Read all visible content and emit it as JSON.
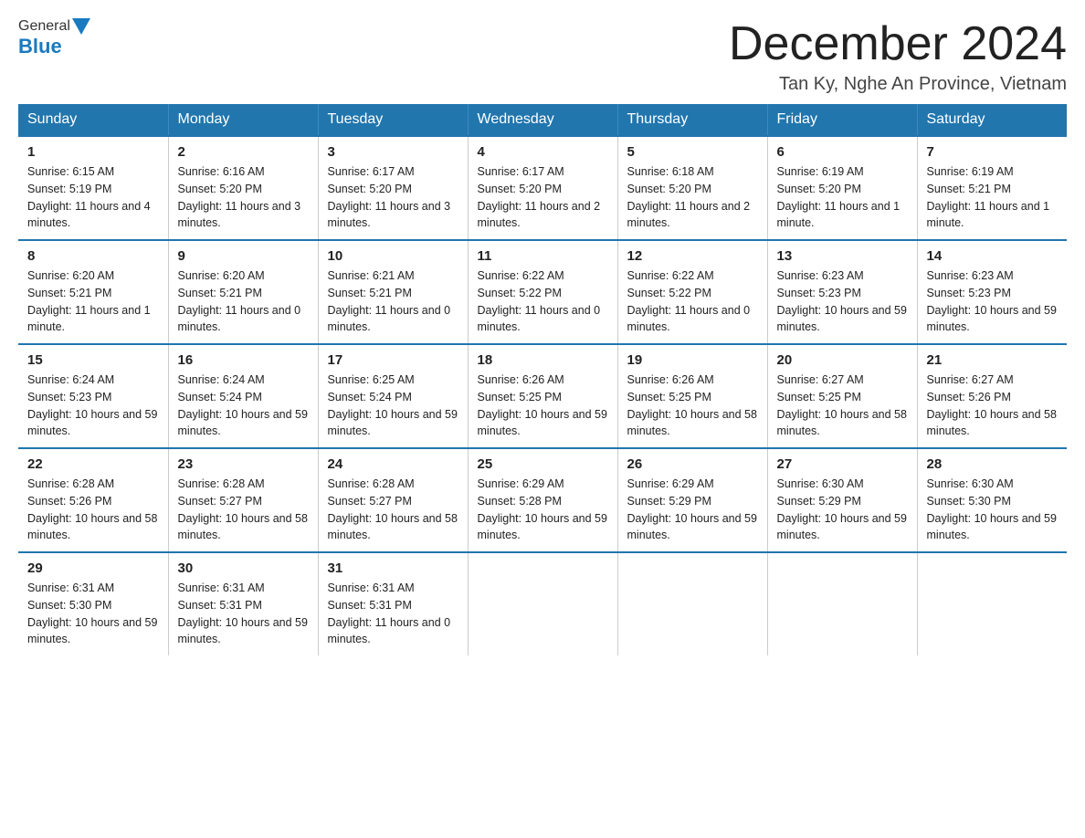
{
  "header": {
    "logo_general": "General",
    "logo_blue": "Blue",
    "month_title": "December 2024",
    "location": "Tan Ky, Nghe An Province, Vietnam"
  },
  "weekdays": [
    "Sunday",
    "Monday",
    "Tuesday",
    "Wednesday",
    "Thursday",
    "Friday",
    "Saturday"
  ],
  "weeks": [
    [
      {
        "day": "1",
        "sunrise": "6:15 AM",
        "sunset": "5:19 PM",
        "daylight": "11 hours and 4 minutes."
      },
      {
        "day": "2",
        "sunrise": "6:16 AM",
        "sunset": "5:20 PM",
        "daylight": "11 hours and 3 minutes."
      },
      {
        "day": "3",
        "sunrise": "6:17 AM",
        "sunset": "5:20 PM",
        "daylight": "11 hours and 3 minutes."
      },
      {
        "day": "4",
        "sunrise": "6:17 AM",
        "sunset": "5:20 PM",
        "daylight": "11 hours and 2 minutes."
      },
      {
        "day": "5",
        "sunrise": "6:18 AM",
        "sunset": "5:20 PM",
        "daylight": "11 hours and 2 minutes."
      },
      {
        "day": "6",
        "sunrise": "6:19 AM",
        "sunset": "5:20 PM",
        "daylight": "11 hours and 1 minute."
      },
      {
        "day": "7",
        "sunrise": "6:19 AM",
        "sunset": "5:21 PM",
        "daylight": "11 hours and 1 minute."
      }
    ],
    [
      {
        "day": "8",
        "sunrise": "6:20 AM",
        "sunset": "5:21 PM",
        "daylight": "11 hours and 1 minute."
      },
      {
        "day": "9",
        "sunrise": "6:20 AM",
        "sunset": "5:21 PM",
        "daylight": "11 hours and 0 minutes."
      },
      {
        "day": "10",
        "sunrise": "6:21 AM",
        "sunset": "5:21 PM",
        "daylight": "11 hours and 0 minutes."
      },
      {
        "day": "11",
        "sunrise": "6:22 AM",
        "sunset": "5:22 PM",
        "daylight": "11 hours and 0 minutes."
      },
      {
        "day": "12",
        "sunrise": "6:22 AM",
        "sunset": "5:22 PM",
        "daylight": "11 hours and 0 minutes."
      },
      {
        "day": "13",
        "sunrise": "6:23 AM",
        "sunset": "5:23 PM",
        "daylight": "10 hours and 59 minutes."
      },
      {
        "day": "14",
        "sunrise": "6:23 AM",
        "sunset": "5:23 PM",
        "daylight": "10 hours and 59 minutes."
      }
    ],
    [
      {
        "day": "15",
        "sunrise": "6:24 AM",
        "sunset": "5:23 PM",
        "daylight": "10 hours and 59 minutes."
      },
      {
        "day": "16",
        "sunrise": "6:24 AM",
        "sunset": "5:24 PM",
        "daylight": "10 hours and 59 minutes."
      },
      {
        "day": "17",
        "sunrise": "6:25 AM",
        "sunset": "5:24 PM",
        "daylight": "10 hours and 59 minutes."
      },
      {
        "day": "18",
        "sunrise": "6:26 AM",
        "sunset": "5:25 PM",
        "daylight": "10 hours and 59 minutes."
      },
      {
        "day": "19",
        "sunrise": "6:26 AM",
        "sunset": "5:25 PM",
        "daylight": "10 hours and 58 minutes."
      },
      {
        "day": "20",
        "sunrise": "6:27 AM",
        "sunset": "5:25 PM",
        "daylight": "10 hours and 58 minutes."
      },
      {
        "day": "21",
        "sunrise": "6:27 AM",
        "sunset": "5:26 PM",
        "daylight": "10 hours and 58 minutes."
      }
    ],
    [
      {
        "day": "22",
        "sunrise": "6:28 AM",
        "sunset": "5:26 PM",
        "daylight": "10 hours and 58 minutes."
      },
      {
        "day": "23",
        "sunrise": "6:28 AM",
        "sunset": "5:27 PM",
        "daylight": "10 hours and 58 minutes."
      },
      {
        "day": "24",
        "sunrise": "6:28 AM",
        "sunset": "5:27 PM",
        "daylight": "10 hours and 58 minutes."
      },
      {
        "day": "25",
        "sunrise": "6:29 AM",
        "sunset": "5:28 PM",
        "daylight": "10 hours and 59 minutes."
      },
      {
        "day": "26",
        "sunrise": "6:29 AM",
        "sunset": "5:29 PM",
        "daylight": "10 hours and 59 minutes."
      },
      {
        "day": "27",
        "sunrise": "6:30 AM",
        "sunset": "5:29 PM",
        "daylight": "10 hours and 59 minutes."
      },
      {
        "day": "28",
        "sunrise": "6:30 AM",
        "sunset": "5:30 PM",
        "daylight": "10 hours and 59 minutes."
      }
    ],
    [
      {
        "day": "29",
        "sunrise": "6:31 AM",
        "sunset": "5:30 PM",
        "daylight": "10 hours and 59 minutes."
      },
      {
        "day": "30",
        "sunrise": "6:31 AM",
        "sunset": "5:31 PM",
        "daylight": "10 hours and 59 minutes."
      },
      {
        "day": "31",
        "sunrise": "6:31 AM",
        "sunset": "5:31 PM",
        "daylight": "11 hours and 0 minutes."
      },
      null,
      null,
      null,
      null
    ]
  ]
}
